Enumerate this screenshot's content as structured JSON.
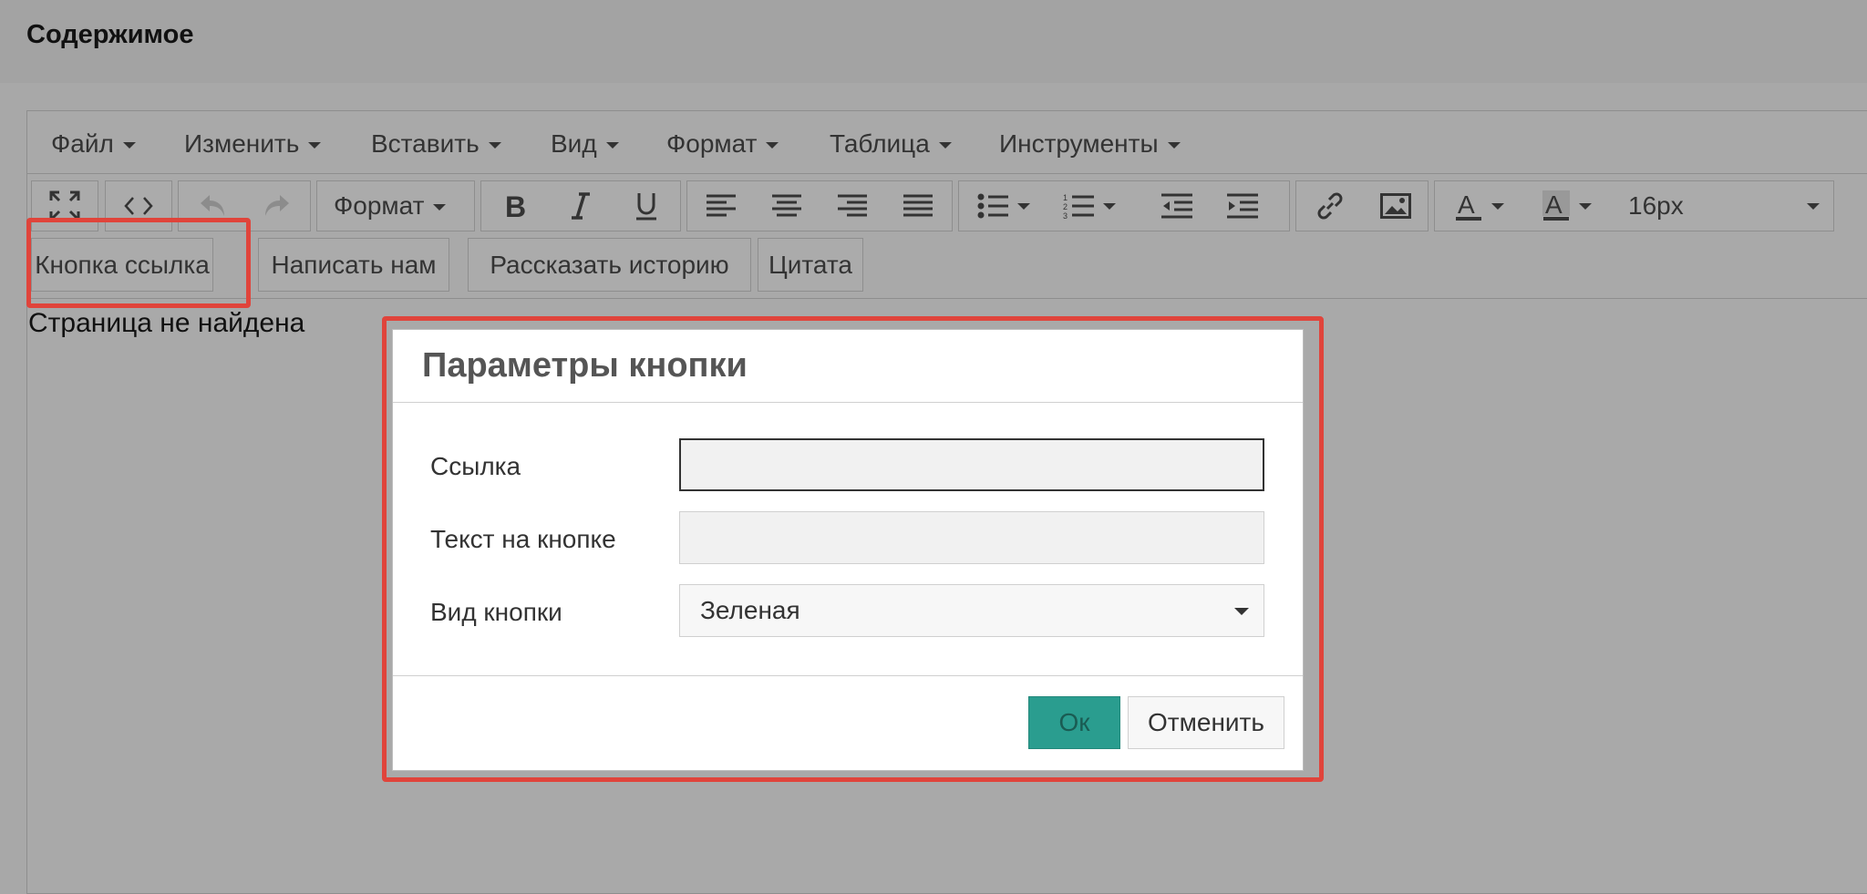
{
  "page": {
    "title": "Содержимое"
  },
  "menubar": {
    "items": [
      {
        "label": "Файл"
      },
      {
        "label": "Изменить"
      },
      {
        "label": "Вставить"
      },
      {
        "label": "Вид"
      },
      {
        "label": "Формат"
      },
      {
        "label": "Таблица"
      },
      {
        "label": "Инструменты"
      }
    ]
  },
  "toolbar": {
    "format_label": "Формат",
    "font_size": "16px",
    "icons": [
      "fullscreen-icon",
      "source-code-icon",
      "undo-icon",
      "redo-icon",
      "bold-icon",
      "italic-icon",
      "underline-icon",
      "align-left-icon",
      "align-center-icon",
      "align-right-icon",
      "align-justify-icon",
      "bullet-list-icon",
      "numbered-list-icon",
      "outdent-icon",
      "indent-icon",
      "link-icon",
      "image-icon",
      "text-color-icon",
      "background-color-icon"
    ]
  },
  "custom_buttons": [
    {
      "label": "Кнопка ссылка"
    },
    {
      "label": "Написать нам"
    },
    {
      "label": "Рассказать историю"
    },
    {
      "label": "Цитата"
    }
  ],
  "content": {
    "text": "Страница не найдена"
  },
  "dialog": {
    "title": "Параметры кнопки",
    "link_label": "Ссылка",
    "link_value": "",
    "text_label": "Текст на кнопке",
    "text_value": "",
    "style_label": "Вид кнопки",
    "style_value": "Зеленая",
    "ok_label": "Ок",
    "cancel_label": "Отменить"
  },
  "colors": {
    "highlight": "#e0443b",
    "ok_button": "#2a9d8f",
    "overlay": "#a8a8a8"
  }
}
